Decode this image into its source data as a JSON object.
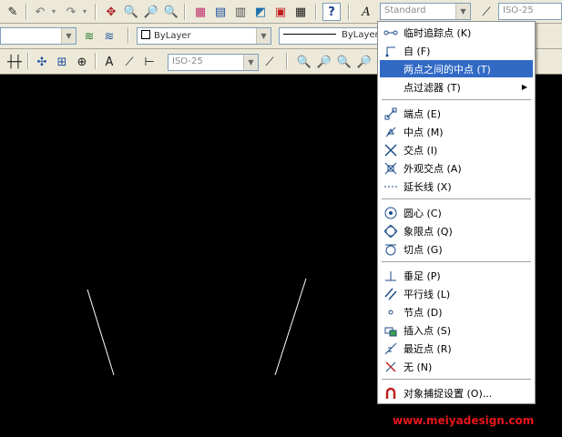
{
  "toolbar1": {
    "text_style_combo": "Standard",
    "dim_style_combo": "ISO-25"
  },
  "toolbar2": {
    "color_combo": "ByLayer",
    "linetype_combo": "ByLayer"
  },
  "toolbar3": {
    "dim_style_combo": "ISO-25"
  },
  "menu": {
    "items": [
      {
        "label": "临时追踪点",
        "key": "(K)",
        "icon": "temp-track-icon"
      },
      {
        "label": "自",
        "key": "(F)",
        "icon": "from-icon"
      },
      {
        "label": "两点之间的中点",
        "key": "(T)",
        "icon": "",
        "highlighted": true
      },
      {
        "label": "点过滤器",
        "key": "(T)",
        "icon": "",
        "submenu": true
      },
      {
        "label": "端点",
        "key": "(E)",
        "icon": "endpoint-icon"
      },
      {
        "label": "中点",
        "key": "(M)",
        "icon": "midpoint-icon"
      },
      {
        "label": "交点",
        "key": "(I)",
        "icon": "intersection-icon"
      },
      {
        "label": "外观交点",
        "key": "(A)",
        "icon": "apparent-intersection-icon"
      },
      {
        "label": "延长线",
        "key": "(X)",
        "icon": "extension-icon"
      },
      {
        "label": "圆心",
        "key": "(C)",
        "icon": "center-icon"
      },
      {
        "label": "象限点",
        "key": "(Q)",
        "icon": "quadrant-icon"
      },
      {
        "label": "切点",
        "key": "(G)",
        "icon": "tangent-icon"
      },
      {
        "label": "垂足",
        "key": "(P)",
        "icon": "perpendicular-icon"
      },
      {
        "label": "平行线",
        "key": "(L)",
        "icon": "parallel-icon"
      },
      {
        "label": "节点",
        "key": "(D)",
        "icon": "node-icon"
      },
      {
        "label": "插入点",
        "key": "(S)",
        "icon": "insert-icon"
      },
      {
        "label": "最近点",
        "key": "(R)",
        "icon": "nearest-icon"
      },
      {
        "label": "无",
        "key": "(N)",
        "icon": "none-icon"
      },
      {
        "label": "对象捕捉设置",
        "key": "(O)...",
        "icon": "osnap-settings-icon"
      }
    ]
  },
  "watermark": "www.meiyadesign.com"
}
